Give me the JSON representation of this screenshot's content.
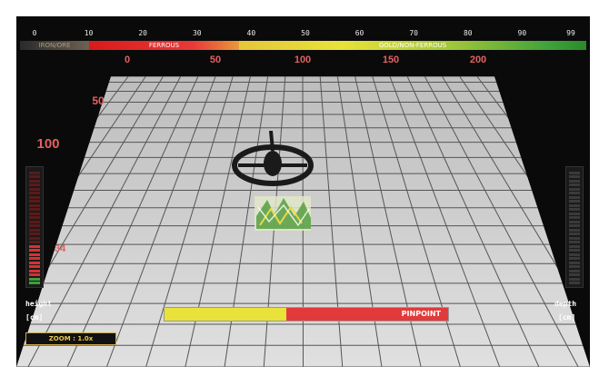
{
  "scale": {
    "numbers": [
      "0",
      "10",
      "20",
      "30",
      "40",
      "50",
      "60",
      "70",
      "80",
      "90",
      "99"
    ],
    "zones": {
      "iron": "IRON/ORE",
      "ferrous": "FERROUS",
      "gold": "GOLD/NON-FERROUS"
    }
  },
  "distance": {
    "top_labels": [
      "0",
      "50",
      "100",
      "150",
      "200"
    ],
    "side_labels": [
      "50",
      "100"
    ]
  },
  "height": {
    "label_line1": "height",
    "label_line2": "[cm]",
    "value": "34",
    "level_fraction": 0.34
  },
  "depth": {
    "label_line1": "depth",
    "label_line2": "[cm]",
    "level_fraction": 0.0
  },
  "pinpoint": {
    "label": "PINPOINT",
    "fill_fraction": 0.43
  },
  "zoom": {
    "label": "ZOOM : 1.0x"
  },
  "colors": {
    "ferrous": "#e23a3a",
    "gold": "#e8e23a",
    "nonferrous": "#3ea03a",
    "grid_light": "#d8d8d8",
    "grid_line": "#505050"
  },
  "icons": [
    "search-coil-icon",
    "target-object-icon"
  ]
}
